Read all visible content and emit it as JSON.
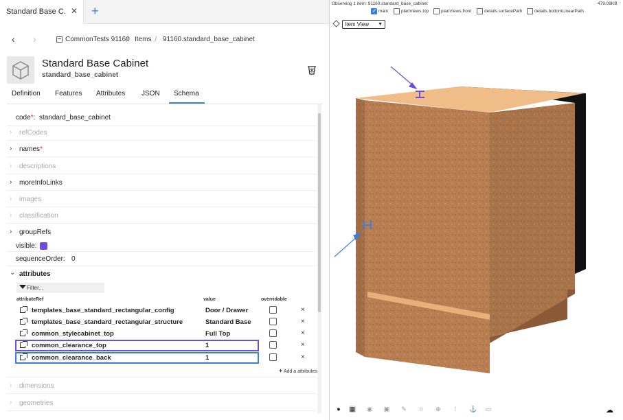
{
  "tab": {
    "title": "Standard Base C...",
    "close": "✕",
    "add": "+"
  },
  "nav": {
    "back": "‹",
    "forward": "›"
  },
  "breadcrumb": [
    "CommonTests 91160",
    "Items",
    "91160.standard_base_cabinet"
  ],
  "item": {
    "title": "Standard Base Cabinet",
    "code": "standard_base_cabinet"
  },
  "subtabs": [
    "Definition",
    "Features",
    "Attributes",
    "JSON",
    "Schema"
  ],
  "schema": {
    "code_label": "code",
    "code_value": "standard_base_cabinet",
    "rows": [
      {
        "label": "refCodes",
        "enabled": false
      },
      {
        "label": "names",
        "enabled": true,
        "required": true
      },
      {
        "label": "descriptions",
        "enabled": false
      },
      {
        "label": "moreInfoLinks",
        "enabled": true
      },
      {
        "label": "images",
        "enabled": false
      },
      {
        "label": "classification",
        "enabled": false
      },
      {
        "label": "groupRefs",
        "enabled": true
      }
    ],
    "visible_label": "visible:",
    "sequence_label": "sequenceOrder:",
    "sequence_value": "0",
    "attributes_label": "attributes",
    "filter_placeholder": "Filter...",
    "col_attr": "attributeRef",
    "col_value": "value",
    "col_overridable": "overridable",
    "attributes": [
      {
        "name": "templates_base_standard_rectangular_config",
        "value": "Door / Drawer"
      },
      {
        "name": "templates_base_standard_rectangular_structure",
        "value": "Standard Base"
      },
      {
        "name": "common_stylecabinet_top",
        "value": "Full Top"
      },
      {
        "name": "common_clearance_top",
        "value": "1"
      },
      {
        "name": "common_clearance_back",
        "value": "1"
      }
    ],
    "remove_symbol": "×",
    "add_attributes": "Add a attributes",
    "bottom_rows": [
      {
        "label": "dimensions"
      },
      {
        "label": "geometries"
      }
    ]
  },
  "viewer": {
    "observing": "Observing 1 item: 91160.standard_base_cabinet",
    "size": "479.09KB",
    "options": [
      {
        "label": "main",
        "checked": true
      },
      {
        "label": "planViews.top",
        "checked": false
      },
      {
        "label": "planViews.front",
        "checked": false
      },
      {
        "label": "details.surfacePath",
        "checked": false
      },
      {
        "label": "details.bottomLinearPath",
        "checked": false
      }
    ],
    "view_mode": "Item View",
    "toolbar_icons": [
      "palette-icon",
      "grid-icon",
      "compass-icon",
      "cube-icon",
      "brush-icon",
      "crop-icon",
      "target-icon",
      "dots-grid-icon",
      "anchor-icon",
      "image-icon"
    ],
    "clearance_marker_top": "I",
    "clearance_marker_back": "H"
  }
}
